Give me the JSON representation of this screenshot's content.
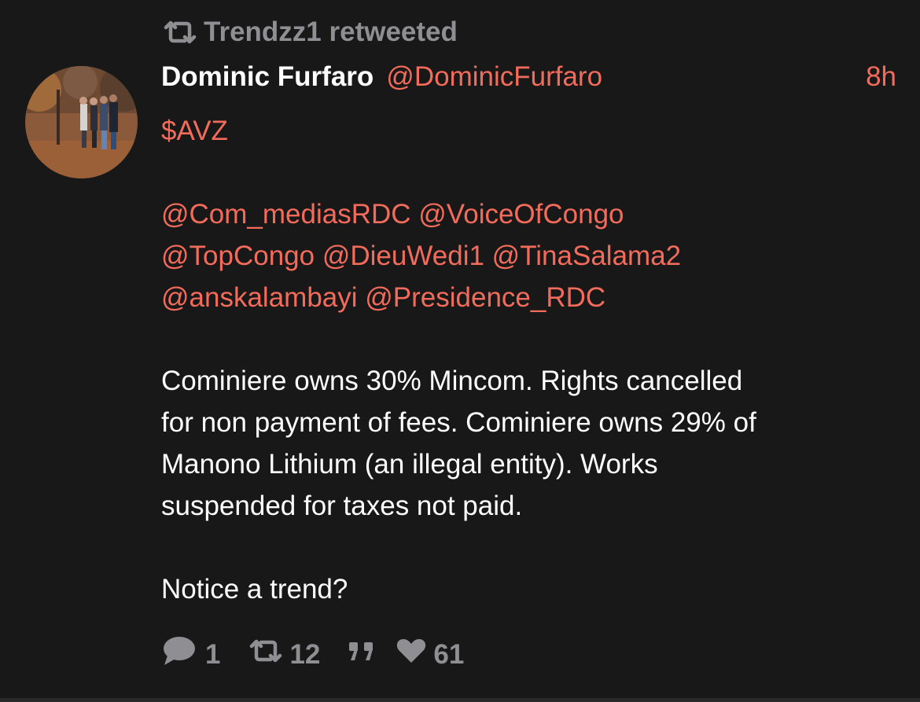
{
  "context": {
    "retweeted_by": "Trendzz1 retweeted"
  },
  "tweet": {
    "display_name": "Dominic Furfaro",
    "handle": "@DominicFurfaro",
    "time": "8h",
    "cashtag": "$AVZ",
    "mentions": [
      "@Com_mediasRDC",
      "@VoiceOfCongo",
      "@TopCongo",
      "@DieuWedi1",
      "@TinaSalama2",
      "@anskalambayi",
      "@Presidence_RDC"
    ],
    "body_lines": [
      "Cominiere owns 30% Mincom. Rights cancelled",
      "for non payment of fees. Cominiere owns 29% of",
      "Manono Lithium (an illegal entity). Works",
      "suspended for taxes not paid."
    ],
    "closing": "Notice a trend?"
  },
  "actions": {
    "reply_count": "1",
    "retweet_count": "12",
    "like_count": "61"
  },
  "colors": {
    "accent": "#f26b5b",
    "muted": "#8e8e93",
    "background": "#181818",
    "text": "#ffffff"
  },
  "icons": {
    "retweet_context": "retweet-icon",
    "reply": "reply-icon",
    "retweet": "retweet-icon",
    "quote": "quote-icon",
    "like": "heart-icon"
  }
}
